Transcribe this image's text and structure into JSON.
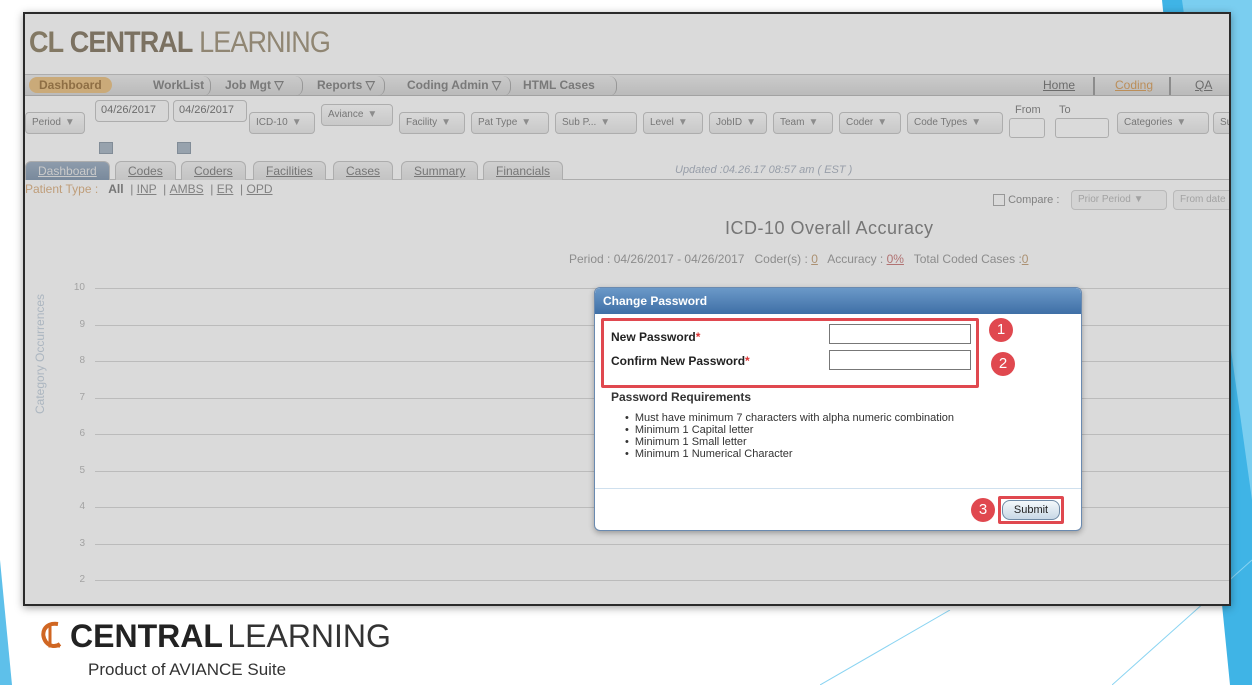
{
  "app": {
    "logo_prefix": "CL",
    "logo_text_1": "CENTRAL",
    "logo_text_2": "LEARNING"
  },
  "nav": {
    "items": [
      "Dashboard",
      "WorkList",
      "Job Mgt",
      "Reports",
      "Coding Admin",
      "HTML Cases"
    ],
    "right_items": [
      "Home",
      "Coding",
      "QA"
    ]
  },
  "filters": {
    "period": "Period",
    "date_from": "04/26/2017",
    "date_to": "04/26/2017",
    "code_set": "ICD-10",
    "client": "Aviance",
    "facility": "Facility",
    "pat_type": "Pat Type",
    "sub_p": "Sub P...",
    "level": "Level",
    "jobid": "JobID",
    "team": "Team",
    "coder": "Coder",
    "code_types": "Code Types",
    "from_label": "From",
    "to_label": "To",
    "categories": "Categories",
    "sub": "Sub"
  },
  "tabs": [
    "Dashboard",
    "Codes",
    "Coders",
    "Facilities",
    "Cases",
    "Summary",
    "Financials"
  ],
  "updated": "Updated :04.26.17 08:57 am ( EST )",
  "patient_type": {
    "label": "Patient Type :",
    "options": [
      "All",
      "INP",
      "AMBS",
      "ER",
      "OPD"
    ]
  },
  "compare": {
    "label": "Compare :",
    "period_select": "Prior Period",
    "from_date": "From date"
  },
  "chart": {
    "title": "ICD-10 Overall Accuracy",
    "period_text": "Period : 04/26/2017 - 04/26/2017",
    "coders_label": "Coder(s) :",
    "coders_value": "0",
    "accuracy_label": "Accuracy :",
    "accuracy_value": "0%",
    "total_label": "Total Coded Cases :",
    "total_value": "0",
    "ylabel": "Category Occurrences",
    "yticks": [
      "10",
      "9",
      "8",
      "7",
      "6",
      "5",
      "4",
      "3",
      "2"
    ]
  },
  "dialog": {
    "title": "Change Password",
    "new_password_label": "New Password",
    "confirm_password_label": "Confirm New Password",
    "required_mark": "*",
    "requirements_heading": "Password Requirements",
    "requirements": [
      "Must have minimum 7 characters with alpha numeric combination",
      "Minimum 1 Capital letter",
      "Minimum 1 Small letter",
      "Minimum 1 Numerical Character"
    ],
    "submit_label": "Submit",
    "step_badges": [
      "1",
      "2",
      "3"
    ]
  },
  "branding": {
    "word1": "CENTRAL",
    "word2": "LEARNING",
    "product": "Product of AVIANCE Suite"
  },
  "colors": {
    "highlight": "#e0484f",
    "dialog_header": "#3f6fa6",
    "brand_orange": "#d06622",
    "slide_accent": "#6ec6ea"
  }
}
